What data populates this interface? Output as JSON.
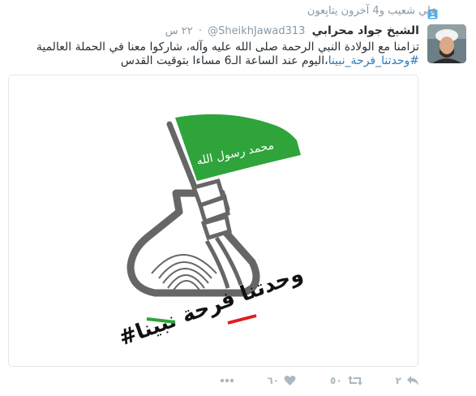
{
  "context": {
    "label": "علي شعيب و4 آخرون يتابِعون",
    "icon": "follow-person-icon"
  },
  "tweet": {
    "author_name": "الشيخ جواد محرابي",
    "handle": "SheikhJawad313@",
    "time": "٢٢ س",
    "text_line1": "تزامنا مع الولادة النبي الرحمة صلى الله عليه وآله، شاركوا معنا في الحملة العالمية",
    "hashtag": "#وحدتنا_فرحة_نبينا",
    "text_line2_rest": "،اليوم عند الساعة الـ6 مساءا بتوقيت القدس",
    "media": {
      "flag_text": "محمد رسول الله",
      "slogan": "#وحدتنا فرحة نبينا",
      "flag_color": "#2ea43a",
      "slogan_colors": [
        "#2ea43a",
        "#e11d1d"
      ]
    }
  },
  "actions": {
    "reply_count": "٢",
    "retweet_count": "٥٠",
    "like_count": "٦٠",
    "icons": [
      "reply-icon",
      "retweet-icon",
      "like-icon",
      "more-icon"
    ]
  },
  "colors": {
    "link": "#2b7bb9",
    "muted": "#8899a6",
    "icon": "#aab8c2"
  }
}
